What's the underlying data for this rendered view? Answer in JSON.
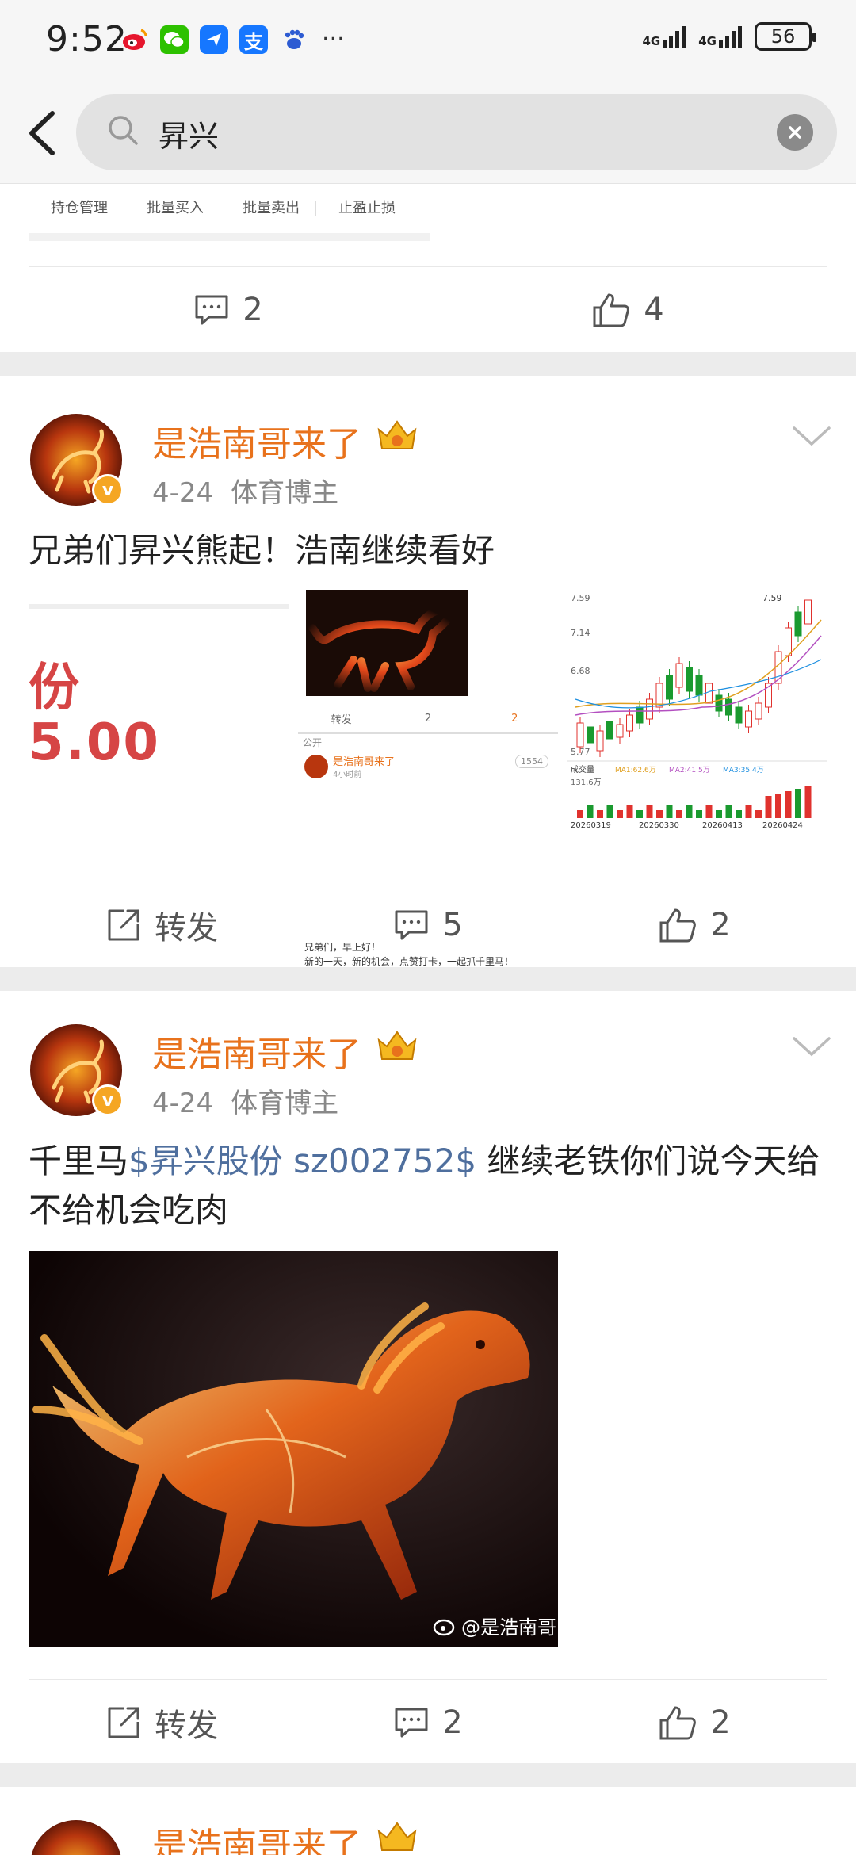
{
  "status_bar": {
    "time": "9:52",
    "app_icons": [
      "weibo-icon",
      "wechat-icon",
      "paper-plane-icon",
      "alipay-icon",
      "baidu-icon"
    ],
    "more": "···",
    "signal_1": "4G",
    "signal_2": "4G",
    "battery": "56"
  },
  "search": {
    "query": "昇兴"
  },
  "card0": {
    "tools": [
      "持仓管理",
      "批量买入",
      "批量卖出",
      "止盈止损"
    ],
    "comments": "2",
    "likes": "4"
  },
  "post1": {
    "username": "是浩南哥来了",
    "date": "4-24",
    "tag": "体育博主",
    "text": "兄弟们昇兴熊起！浩南继续看好",
    "thumb_left": {
      "char": "份",
      "price": "5.00"
    },
    "thumb_mid": {
      "repost": "转发",
      "comments": "2",
      "likes": "2",
      "visibility": "公开",
      "inner_user": "是浩南哥来了",
      "inner_time": "4小时前",
      "inner_views": "1554",
      "inner_text_1": "兄弟们，早上好！",
      "inner_text_2": "新的一天，新的机会，点赞打卡，一起抓千里马！"
    },
    "thumb_chart": {
      "y_labels": [
        "7.59",
        "7.14",
        "6.68",
        "5.77"
      ],
      "high_label": "7.59",
      "volume_label": "成交量",
      "volume_value": "131.6万",
      "ma_labels": [
        "MA1:62.6万",
        "MA2:41.5万",
        "MA3:35.4万"
      ],
      "dates": [
        "20260319",
        "20260330",
        "20260413",
        "20260424"
      ],
      "colors": {
        "up": "#e0322e",
        "down": "#1a9a2f"
      }
    },
    "repost": "转发",
    "comments": "5",
    "likes": "2"
  },
  "post2": {
    "username": "是浩南哥来了",
    "date": "4-24",
    "tag": "体育博主",
    "text_prefix": "千里马",
    "text_link": "$昇兴股份 sz002752$",
    "text_suffix": " 继续老铁你们说今天给不给机会吃肉",
    "watermark": "@是浩南哥",
    "repost": "转发",
    "comments": "2",
    "likes": "2"
  },
  "post3": {
    "username": "是浩南哥来了"
  },
  "colors": {
    "username": "#e8721c",
    "link": "#4f6f9e",
    "meta": "#888888"
  }
}
